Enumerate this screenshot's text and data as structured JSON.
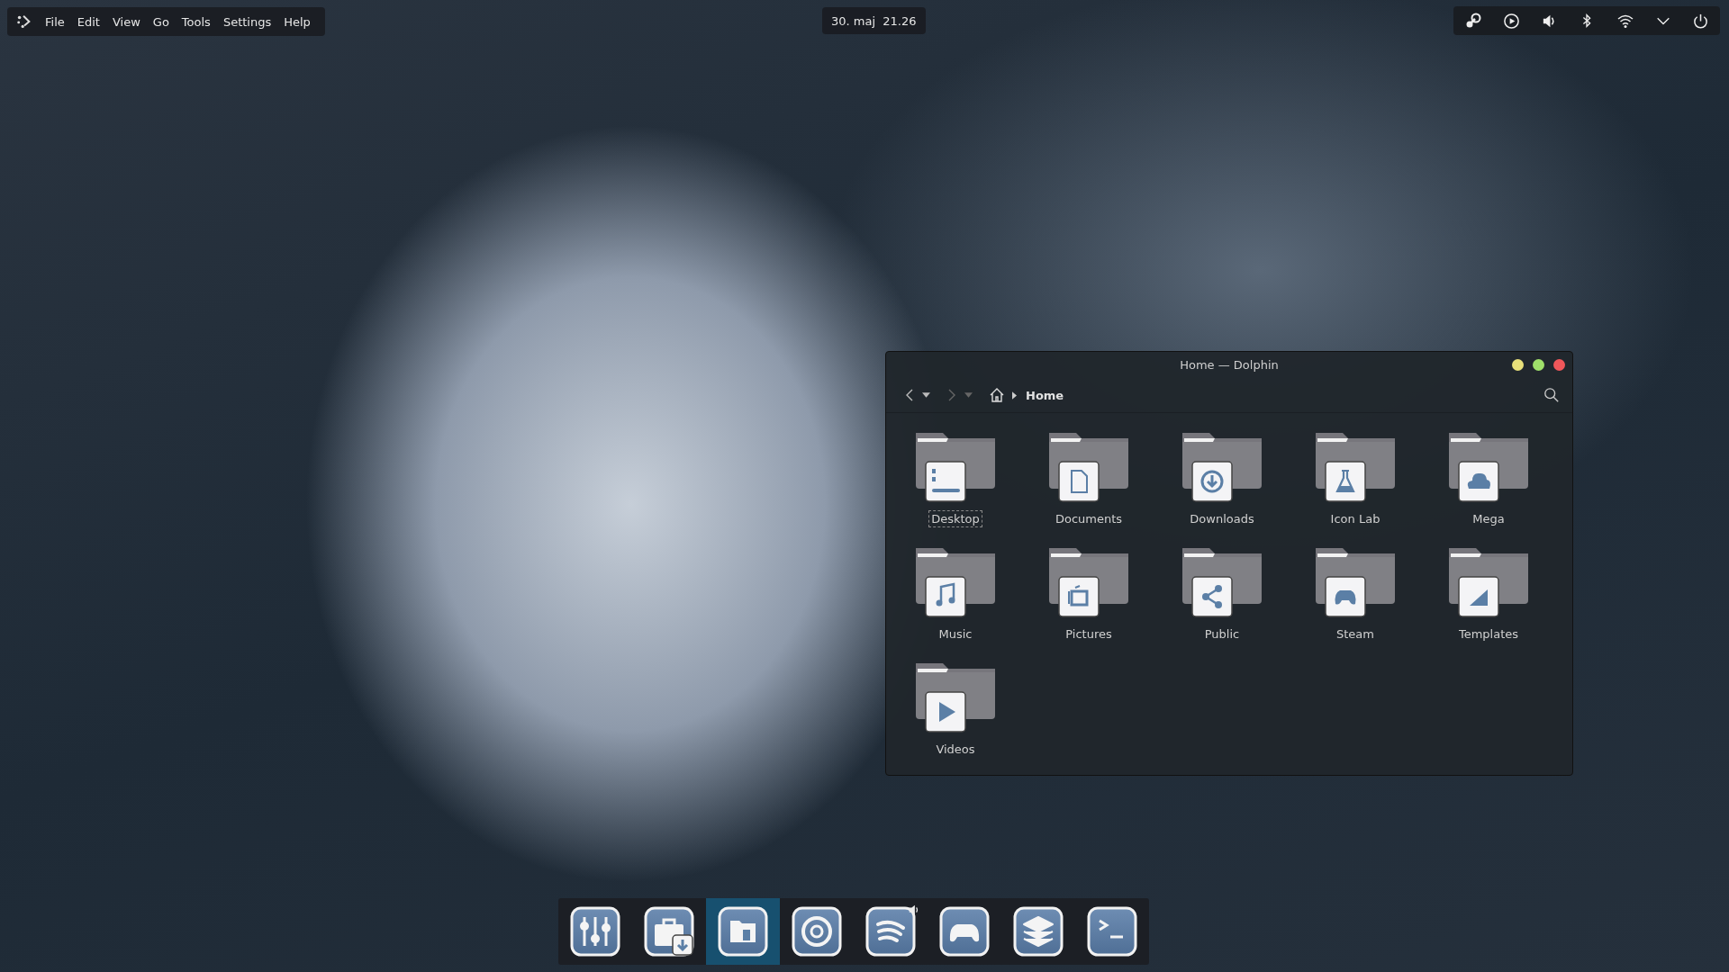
{
  "top_menu": {
    "items": [
      "File",
      "Edit",
      "View",
      "Go",
      "Tools",
      "Settings",
      "Help"
    ]
  },
  "clock": {
    "text": "30. maj  21.26"
  },
  "window": {
    "title": "Home — Dolphin",
    "breadcrumb": "Home",
    "folders": [
      {
        "name": "Desktop",
        "focused": true
      },
      {
        "name": "Documents",
        "focused": false
      },
      {
        "name": "Downloads",
        "focused": false
      },
      {
        "name": "Icon Lab",
        "focused": false
      },
      {
        "name": "Mega",
        "focused": false
      },
      {
        "name": "Music",
        "focused": false
      },
      {
        "name": "Pictures",
        "focused": false
      },
      {
        "name": "Public",
        "focused": false
      },
      {
        "name": "Steam",
        "focused": false
      },
      {
        "name": "Templates",
        "focused": false
      },
      {
        "name": "Videos",
        "focused": false
      }
    ]
  },
  "dock": {
    "items": [
      {
        "selected": false,
        "playing": false
      },
      {
        "selected": false,
        "playing": false
      },
      {
        "selected": true,
        "playing": false
      },
      {
        "selected": false,
        "playing": false
      },
      {
        "selected": false,
        "playing": true
      },
      {
        "selected": false,
        "playing": false
      },
      {
        "selected": false,
        "playing": false
      },
      {
        "selected": false,
        "playing": false
      }
    ]
  }
}
